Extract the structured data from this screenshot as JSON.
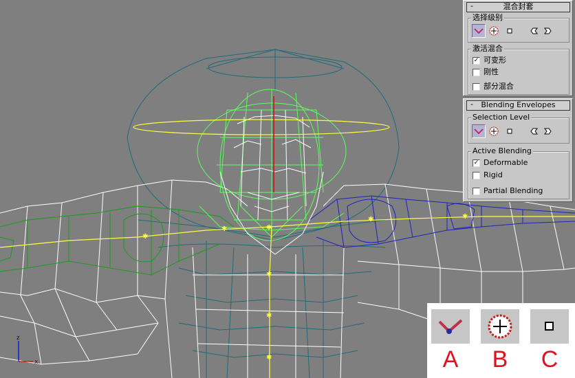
{
  "zh_panel": {
    "title": "混合封套",
    "collapse": "-",
    "selection_level": "选择级别",
    "active_blending": "激活混合",
    "options": [
      {
        "label": "可变形",
        "checked": true
      },
      {
        "label": "刚性",
        "checked": false
      },
      {
        "label": "部分混合",
        "checked": false
      }
    ]
  },
  "en_panel": {
    "title": "Blending Envelopes",
    "collapse": "-",
    "selection_level": "Selection Level",
    "active_blending": "Active Blending",
    "options": [
      {
        "label": "Deformable",
        "checked": true
      },
      {
        "label": "Rigid",
        "checked": false
      },
      {
        "label": "Partial Blending",
        "checked": false
      }
    ]
  },
  "check_mark": "✓",
  "legend": {
    "a": "A",
    "b": "B",
    "c": "C"
  },
  "axis": {
    "z": "z",
    "x": "x"
  },
  "colors": {
    "viewport_bg": "#7f7f7f",
    "panel_bg": "#c7c7c7",
    "pressed_bg": "#b4b4d2",
    "legend_letter": "#e01020",
    "wire_white": "#ffffff",
    "wire_green": "#1b9a1b",
    "wire_blue": "#2020c0",
    "wire_teal": "#206a7a",
    "bone_yellow": "#ffff40",
    "bright_green": "#5cff5c"
  }
}
